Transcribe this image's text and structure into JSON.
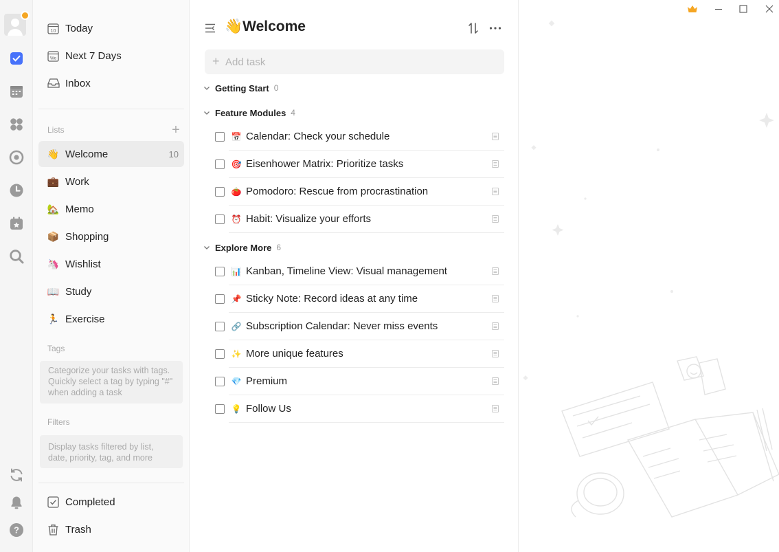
{
  "rail": {
    "icons": [
      "avatar",
      "task-check-icon",
      "calendar-icon",
      "matrix-icon",
      "pomodoro-icon",
      "habit-clock-icon",
      "countdown-icon",
      "search-icon",
      "sync-icon",
      "bell-icon",
      "help-icon"
    ],
    "accent_color": "#4772fa"
  },
  "sidebar": {
    "smart_lists": [
      {
        "label": "Today",
        "icon": "today-calendar-icon"
      },
      {
        "label": "Next 7 Days",
        "icon": "week-calendar-icon"
      },
      {
        "label": "Inbox",
        "icon": "inbox-icon"
      }
    ],
    "lists_header": "Lists",
    "lists": [
      {
        "emoji": "👋",
        "label": "Welcome",
        "count": "10"
      },
      {
        "emoji": "💼",
        "label": "Work",
        "count": ""
      },
      {
        "emoji": "🏡",
        "label": "Memo",
        "count": ""
      },
      {
        "emoji": "📦",
        "label": "Shopping",
        "count": ""
      },
      {
        "emoji": "🦄",
        "label": "Wishlist",
        "count": ""
      },
      {
        "emoji": "📖",
        "label": "Study",
        "count": ""
      },
      {
        "emoji": "🏃",
        "label": "Exercise",
        "count": ""
      }
    ],
    "tags_header": "Tags",
    "tags_hint": "Categorize your tasks with tags. Quickly select a tag by typing \"#\" when adding a task",
    "filters_header": "Filters",
    "filters_hint": "Display tasks filtered by list, date, priority, tag, and more",
    "bottom": [
      {
        "label": "Completed",
        "icon": "completed-check-icon"
      },
      {
        "label": "Trash",
        "icon": "trash-icon"
      }
    ]
  },
  "main": {
    "title_emoji": "👋",
    "title": "Welcome",
    "add_task_placeholder": "Add task",
    "groups": [
      {
        "name": "Getting Start",
        "count": "0",
        "tasks": []
      },
      {
        "name": "Feature Modules",
        "count": "4",
        "tasks": [
          {
            "emoji": "📅",
            "title": "Calendar: Check your schedule"
          },
          {
            "emoji": "🎯",
            "title": "Eisenhower Matrix: Prioritize tasks"
          },
          {
            "emoji": "🍅",
            "title": "Pomodoro: Rescue from procrastination"
          },
          {
            "emoji": "⏰",
            "title": "Habit: Visualize your efforts"
          }
        ]
      },
      {
        "name": "Explore More",
        "count": "6",
        "tasks": [
          {
            "emoji": "📊",
            "title": "Kanban, Timeline View: Visual management"
          },
          {
            "emoji": "📌",
            "title": "Sticky Note: Record ideas at any time"
          },
          {
            "emoji": "🔗",
            "title": "Subscription Calendar: Never miss events"
          },
          {
            "emoji": "✨",
            "title": "More unique features"
          },
          {
            "emoji": "💎",
            "title": "Premium"
          },
          {
            "emoji": "💡",
            "title": "Follow Us"
          }
        ]
      }
    ]
  },
  "window": {
    "controls": [
      "premium-crown-icon",
      "minimize-icon",
      "maximize-icon",
      "close-icon"
    ],
    "crown_color": "#f5a623"
  }
}
